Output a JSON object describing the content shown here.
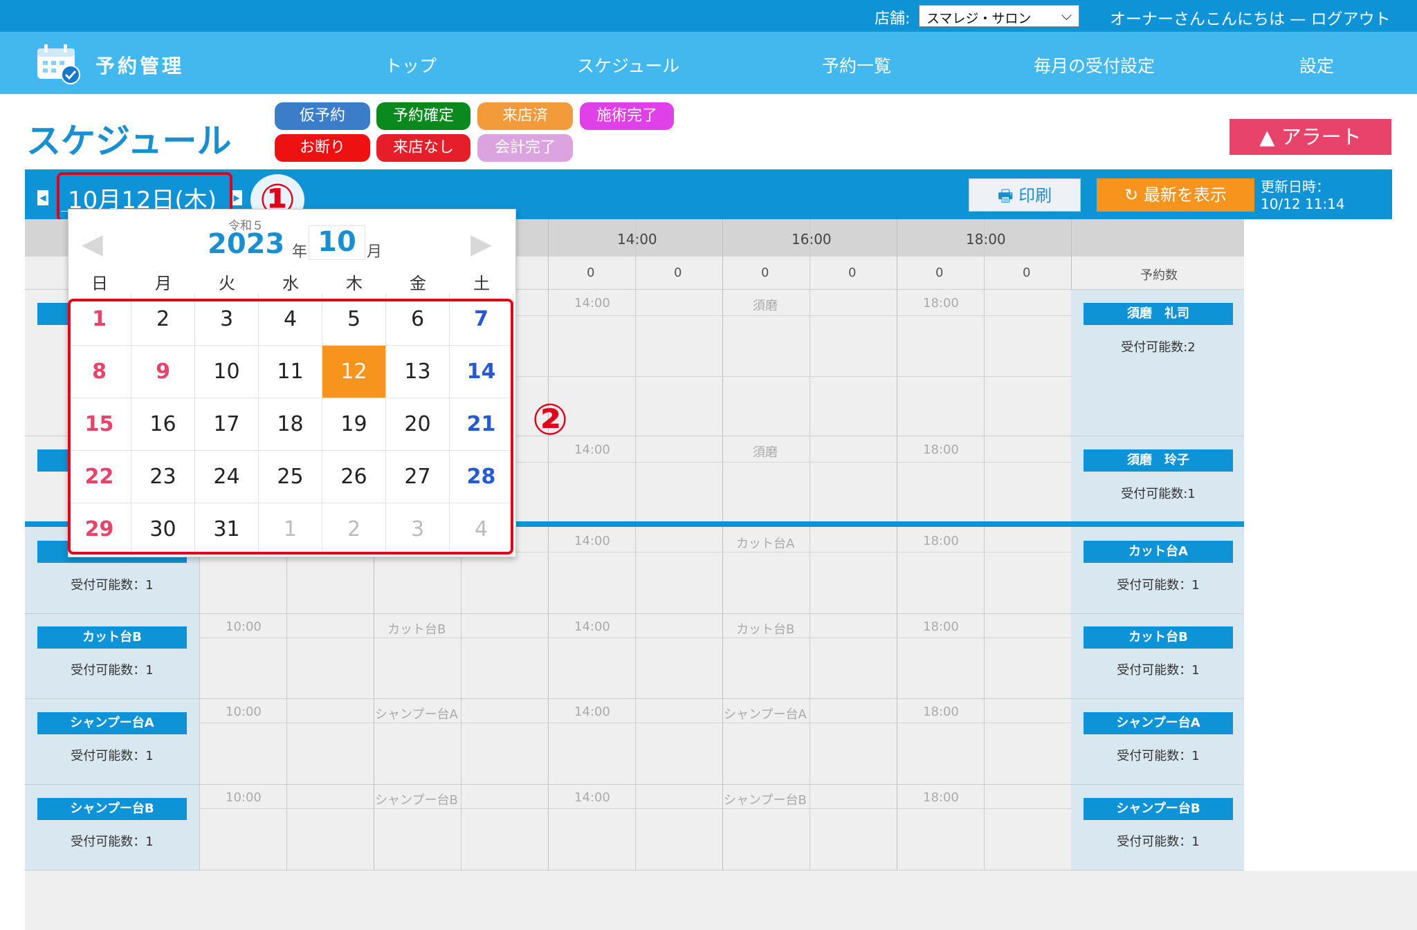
{
  "topbar": {
    "store_label": "店舗:",
    "store_selected": "スマレジ・サロン",
    "greeting": "オーナーさんこんにちは — ログアウト"
  },
  "nav": {
    "app_title": "予約管理",
    "items": [
      "トップ",
      "スケジュール",
      "予約一覧",
      "毎月の受付設定",
      "設定"
    ]
  },
  "page": {
    "title": "スケジュール",
    "alert_label": "アラート"
  },
  "status_badges": [
    {
      "label": "仮予約",
      "color": "#3b7dc9"
    },
    {
      "label": "予約確定",
      "color": "#0a8a1e"
    },
    {
      "label": "来店済",
      "color": "#f39a3a"
    },
    {
      "label": "施術完了",
      "color": "#e040e8"
    },
    {
      "label": "お断り",
      "color": "#ee1111"
    },
    {
      "label": "来店なし",
      "color": "#e61e2a"
    },
    {
      "label": "会計完了",
      "color": "#dba4e0"
    }
  ],
  "datebar": {
    "date": "10月12日(木)",
    "print_label": "印刷",
    "refresh_label": "最新を表示",
    "updated_label": "更新日時：",
    "updated_value": "10/12 11:14"
  },
  "annotations": {
    "one": "①",
    "two": "②"
  },
  "schedule": {
    "header_times": [
      "14:00",
      "16:00",
      "18:00"
    ],
    "counts": [
      "0",
      "0",
      "0",
      "0",
      "0",
      "0"
    ],
    "count_label": "予約数",
    "staff_rows": [
      {
        "name": "須磨　礼司",
        "capacity": "受付可能数:2",
        "cells": [
          "14:00",
          "須磨",
          "18:00"
        ]
      },
      {
        "name": "須磨　玲子",
        "capacity": "受付可能数:1",
        "cells": [
          "14:00",
          "須磨",
          "18:00"
        ]
      }
    ],
    "equipment_rows": [
      {
        "name": "カット台A",
        "capacity": "受付可能数：1",
        "cells": [
          "14:00",
          "カット台A",
          "18:00"
        ]
      },
      {
        "name": "カット台B",
        "capacity": "受付可能数：1",
        "cells": [
          "10:00",
          "カット台B",
          "14:00",
          "カット台B",
          "18:00"
        ]
      },
      {
        "name": "シャンプー台A",
        "capacity": "受付可能数：1",
        "cells": [
          "10:00",
          "シャンプー台A",
          "14:00",
          "シャンプー台A",
          "18:00"
        ]
      },
      {
        "name": "シャンプー台B",
        "capacity": "受付可能数：1",
        "cells": [
          "10:00",
          "シャンプー台B",
          "14:00",
          "シャンプー台B",
          "18:00"
        ]
      }
    ]
  },
  "calendar": {
    "era": "令和５",
    "year": "2023",
    "year_suffix": "年",
    "month": "10",
    "month_suffix": "月",
    "weekdays": [
      "日",
      "月",
      "火",
      "水",
      "木",
      "金",
      "土"
    ],
    "weeks": [
      [
        "1",
        "2",
        "3",
        "4",
        "5",
        "6",
        "7"
      ],
      [
        "8",
        "9",
        "10",
        "11",
        "12",
        "13",
        "14"
      ],
      [
        "15",
        "16",
        "17",
        "18",
        "19",
        "20",
        "21"
      ],
      [
        "22",
        "23",
        "24",
        "25",
        "26",
        "27",
        "28"
      ],
      [
        "29",
        "30",
        "31",
        "1",
        "2",
        "3",
        "4"
      ]
    ],
    "holidays": [
      "9"
    ],
    "selected_day": "12",
    "next_month_days_in_last_week": 4
  }
}
